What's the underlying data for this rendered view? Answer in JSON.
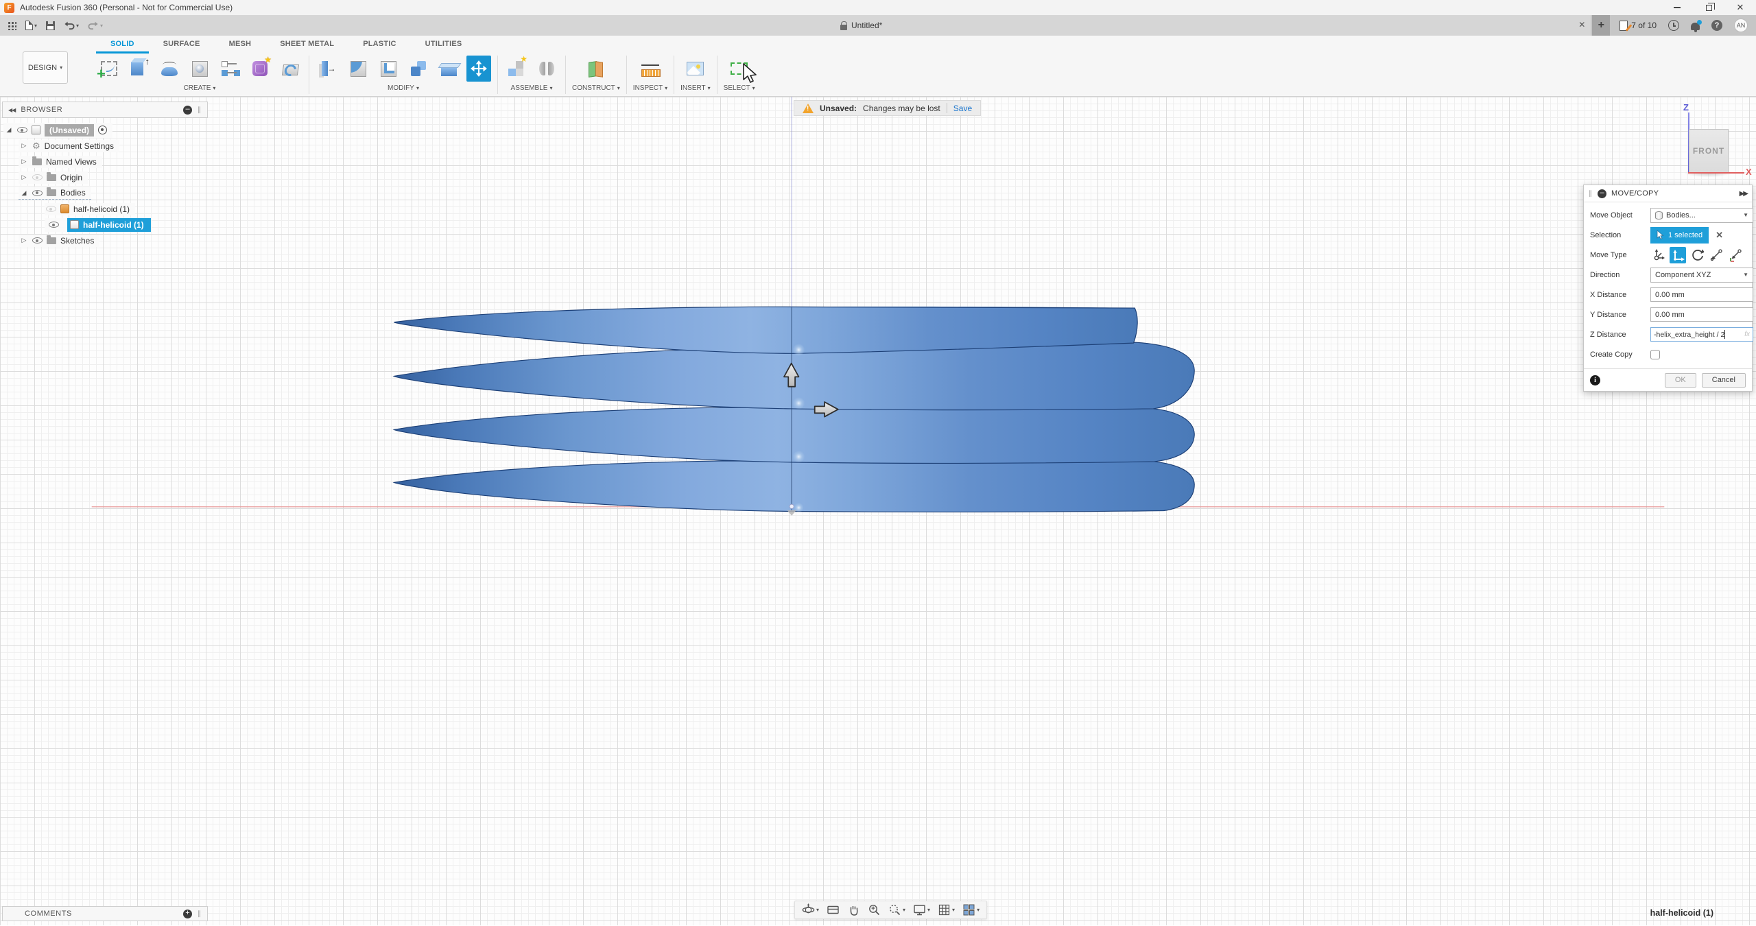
{
  "window": {
    "title": "Autodesk Fusion 360 (Personal - Not for Commercial Use)"
  },
  "tab_bar": {
    "active_tab": "Untitled*",
    "new_tab_label": "+",
    "documents_counter": "7 of 10",
    "avatar_initials": "AN"
  },
  "quick_access": {
    "icons": [
      "app-launcher",
      "file-new",
      "save",
      "undo",
      "redo"
    ]
  },
  "ribbon": {
    "design_menu_label": "DESIGN",
    "tabs": [
      "SOLID",
      "SURFACE",
      "MESH",
      "SHEET METAL",
      "PLASTIC",
      "UTILITIES"
    ],
    "active_tab": "SOLID",
    "groups": [
      {
        "label": "CREATE",
        "icons": [
          "create-sketch",
          "extrude",
          "revolve",
          "hole",
          "pattern",
          "create-form",
          "coil"
        ]
      },
      {
        "label": "MODIFY",
        "icons": [
          "press-pull",
          "fillet",
          "shell",
          "combine",
          "split-body",
          "move-copy"
        ]
      },
      {
        "label": "ASSEMBLE",
        "icons": [
          "new-component",
          "joint"
        ]
      },
      {
        "label": "CONSTRUCT",
        "icons": [
          "construction-plane"
        ]
      },
      {
        "label": "INSPECT",
        "icons": [
          "measure"
        ]
      },
      {
        "label": "INSERT",
        "icons": [
          "insert-canvas"
        ]
      },
      {
        "label": "SELECT",
        "icons": [
          "box-select"
        ]
      }
    ],
    "active_tool": "move-copy"
  },
  "message_bar": {
    "label": "Unsaved:",
    "message": "Changes may be lost",
    "action": "Save"
  },
  "browser": {
    "header": "BROWSER",
    "items": [
      {
        "label": "(Unsaved)",
        "type": "document-root",
        "state": "active"
      },
      {
        "label": "Document Settings"
      },
      {
        "label": "Named Views"
      },
      {
        "label": "Origin",
        "visibility": "hidden"
      },
      {
        "label": "Bodies"
      },
      {
        "label": "half-helicoid (1)",
        "visibility": "hidden"
      },
      {
        "label": "half-helicoid (1)",
        "state": "selected"
      },
      {
        "label": "Sketches"
      }
    ]
  },
  "viewcube": {
    "face": "FRONT",
    "axis_vertical": "Z",
    "axis_horizontal": "X"
  },
  "dialog": {
    "title": "MOVE/COPY",
    "move_object": {
      "label": "Move Object",
      "value": "Bodies..."
    },
    "selection": {
      "label": "Selection",
      "chip": "1 selected"
    },
    "move_type": {
      "label": "Move Type",
      "icons": [
        "free-move",
        "translate",
        "rotate",
        "point-to-point",
        "point-to-position"
      ],
      "active": "translate"
    },
    "direction": {
      "label": "Direction",
      "value": "Component XYZ"
    },
    "x_distance": {
      "label": "X Distance",
      "value": "0.00 mm"
    },
    "y_distance": {
      "label": "Y Distance",
      "value": "0.00 mm"
    },
    "z_distance": {
      "label": "Z Distance",
      "value": "-helix_extra_height / 2",
      "fx_hint": "fx"
    },
    "create_copy": {
      "label": "Create Copy",
      "checked": false
    },
    "ok_label": "OK",
    "cancel_label": "Cancel"
  },
  "comments_bar": {
    "label": "COMMENTS"
  },
  "nav_bar": {
    "icons": [
      "orbit",
      "look-at",
      "pan",
      "zoom",
      "fit",
      "display-settings",
      "grid-display",
      "viewports"
    ]
  },
  "status_bar": {
    "selection_label": "half-helicoid (1)"
  },
  "colors": {
    "accent": "#0696d7",
    "selection_blue": "#1f9fd9",
    "warning_orange": "#f2a42c",
    "model_blue": "#5c8ecb",
    "axis_x_red": "#e06666",
    "axis_z_blue": "#8b8fd1"
  }
}
